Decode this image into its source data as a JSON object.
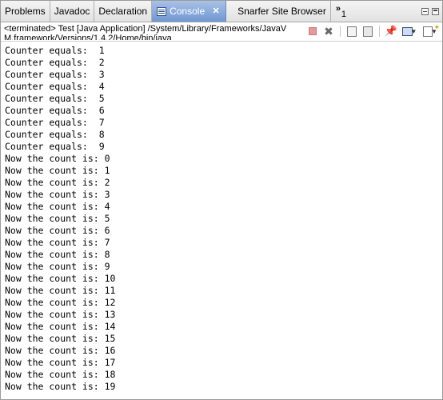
{
  "tabs": [
    {
      "label": "Problems",
      "active": false
    },
    {
      "label": "Javadoc",
      "active": false
    },
    {
      "label": "Declaration",
      "active": false
    },
    {
      "label": "Console",
      "active": true
    },
    {
      "label": "Snarfer Site Browser",
      "active": false
    }
  ],
  "overflow": {
    "chevron": "»",
    "count": "1"
  },
  "header": {
    "text": "<terminated> Test [Java Application] /System/Library/Frameworks/JavaVM.framework/Versions/1.4.2/Home/bin/java"
  },
  "toolbar_icons": [
    "terminate-icon",
    "remove-launches-icon",
    "clear-console-icon",
    "scroll-lock-icon",
    "pin-console-icon",
    "display-selected-console-icon",
    "open-console-icon"
  ],
  "output_lines": [
    "Counter equals:  1",
    "Counter equals:  2",
    "Counter equals:  3",
    "Counter equals:  4",
    "Counter equals:  5",
    "Counter equals:  6",
    "Counter equals:  7",
    "Counter equals:  8",
    "Counter equals:  9",
    "Now the count is: 0",
    "Now the count is: 1",
    "Now the count is: 2",
    "Now the count is: 3",
    "Now the count is: 4",
    "Now the count is: 5",
    "Now the count is: 6",
    "Now the count is: 7",
    "Now the count is: 8",
    "Now the count is: 9",
    "Now the count is: 10",
    "Now the count is: 11",
    "Now the count is: 12",
    "Now the count is: 13",
    "Now the count is: 14",
    "Now the count is: 15",
    "Now the count is: 16",
    "Now the count is: 17",
    "Now the count is: 18",
    "Now the count is: 19"
  ],
  "colors": {
    "active_tab": "#6f97d2",
    "terminate_disabled": "#e39a9a"
  }
}
